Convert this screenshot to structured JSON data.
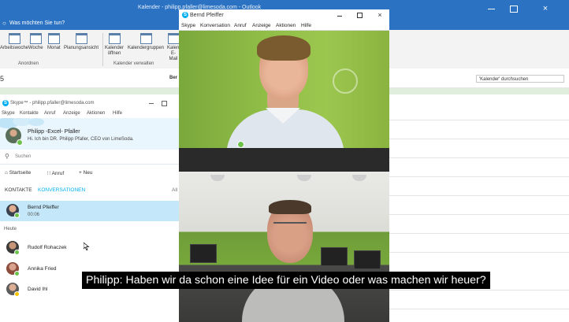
{
  "outlook": {
    "title": "Kalender - philipp.pfaller@limesoda.com - Outlook",
    "tell_me": "Was möchten Sie tun?",
    "ribbon": {
      "buttons": [
        "Arbeitswoche",
        "Woche",
        "Monat",
        "Planungsansicht",
        "Kalender öffnen",
        "Kalendergruppen",
        "Kalender E-Mail"
      ],
      "groups": [
        "Anordnen",
        "Kalender verwalten"
      ]
    },
    "day_number": "5",
    "ber_label": "Ber",
    "search_placeholder": "'Kalender' durchsuchen",
    "close_glyph": "×"
  },
  "skype": {
    "title": "Skype™ - philipp.pfaller@limesoda.com",
    "menu": [
      "Skype",
      "Kontakte",
      "Anruf",
      "Anzeige",
      "Aktionen",
      "Hilfe"
    ],
    "profile": {
      "name": "Philipp -Excel- Pfaller",
      "mood": "Hi. Ich bin DR. Philipp Pfaller, CEO von LimeSoda."
    },
    "search_placeholder": "Suchen",
    "nav": {
      "home": "Startseite",
      "call": "Anruf",
      "new": "Neu"
    },
    "tabs": {
      "contacts": "KONTAKTE",
      "conversations": "KONVERSATIONEN",
      "all": "All"
    },
    "active_conversation": {
      "name": "Bernd Pfeiffer",
      "duration": "00:06"
    },
    "today_label": "Heute",
    "contacts": [
      {
        "name": "Rudolf Rohaczek"
      },
      {
        "name": "Annika Fried"
      },
      {
        "name": "David Ihl"
      }
    ],
    "status_online": "#6cc24a",
    "status_away": "#f5c400",
    "accent": "#00aff0"
  },
  "call": {
    "title": "Bernd Pfeiffer",
    "menu": [
      "Skype",
      "Konversation",
      "Anruf",
      "Anzeige",
      "Aktionen",
      "Hilfe"
    ],
    "close_glyph": "×"
  },
  "subtitle": "Philipp: Haben wir da schon eine Idee für ein Video oder was machen wir heuer?"
}
